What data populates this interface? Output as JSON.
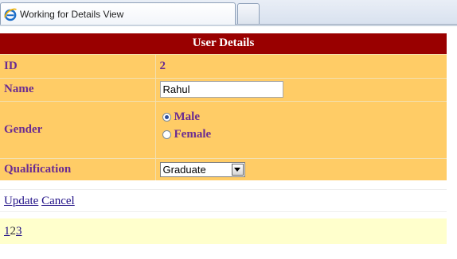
{
  "browser": {
    "tab_title": "Working for Details View",
    "tab_icon": "ie-browser-icon"
  },
  "details": {
    "header": "User Details",
    "rows": [
      {
        "label": "ID",
        "value": "2"
      },
      {
        "label": "Name",
        "value": "Rahul"
      },
      {
        "label": "Gender",
        "options": [
          "Male",
          "Female"
        ],
        "selected": "Male"
      },
      {
        "label": "Qualification",
        "value": "Graduate"
      }
    ]
  },
  "commands": {
    "update": "Update",
    "cancel": "Cancel"
  },
  "pager": {
    "pages": [
      "1",
      "2",
      "3"
    ],
    "current": "2"
  },
  "colors": {
    "header_bg": "#990000",
    "row_bg": "#ffcc66",
    "label_text": "#6b2c91",
    "pager_bg": "#ffffcc",
    "link": "#1f0f86"
  }
}
